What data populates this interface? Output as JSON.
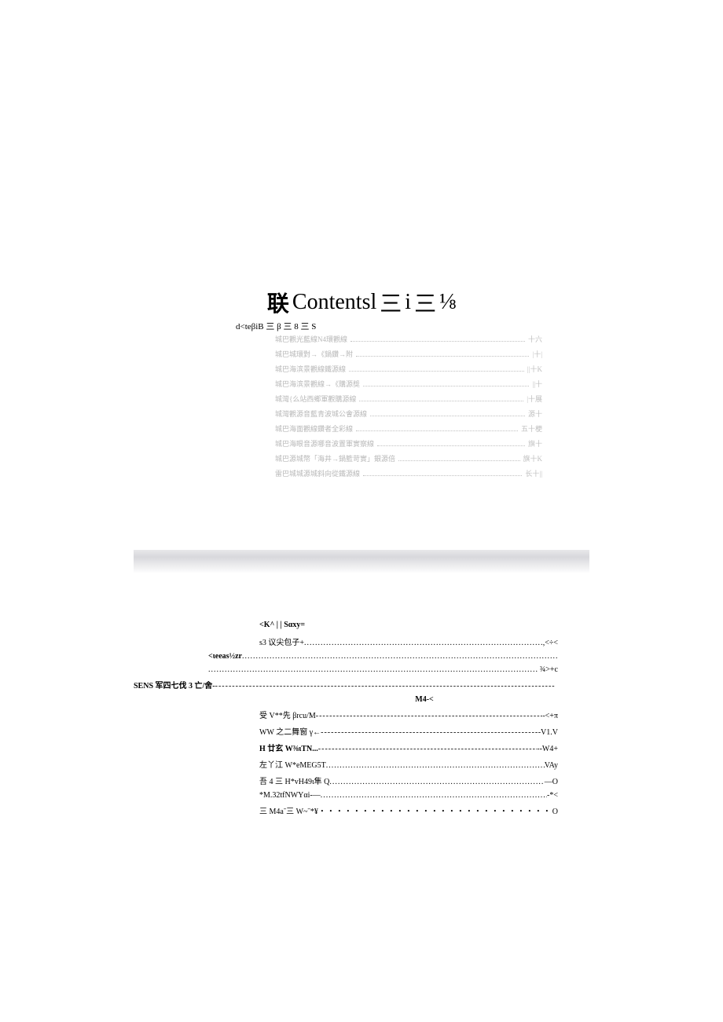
{
  "title": {
    "cjk": "联",
    "main": "Contentsl",
    "tri1": "三",
    "i": "i",
    "tri2": "三",
    "frac": "⅛"
  },
  "subtitle": "d<teβiB 三 β 三 8 三 S",
  "toc_upper": [
    {
      "label": "城巴觀光藍線N4環觀線",
      "page": "十六"
    },
    {
      "label": "城巴城環對→《鍋鑽→附",
      "page": "|十|"
    },
    {
      "label": "城巴海滨景觀線鐵源線",
      "page": "||十K"
    },
    {
      "label": "城巴海滨景觀線→《購源獎",
      "page": "||十"
    },
    {
      "label": "城灣{么站西鄉軍觀購源線",
      "page": "|十展"
    },
    {
      "label": "城灣觀源音藍青波城公會源線",
      "page": "源十"
    },
    {
      "label": "城巴海面觀線鑽者全彩線",
      "page": "五十梗"
    },
    {
      "label": "城巴海眼音源哪音波置軍實察線",
      "page": "旗十"
    },
    {
      "label": "城巴源城幣「海井→鍋籃苛實」銀源倍",
      "page": "旗十K"
    },
    {
      "label": "雷巴城城源城斜向從鐵源線",
      "page": "长十||"
    }
  ],
  "lower": {
    "header": "<K^ | | Sαxy=",
    "lines": [
      {
        "label": "s3 议尖包子+",
        "indent": "indent1",
        "fill": "dots",
        "page": ",<÷<",
        "bold": false
      },
      {
        "label": "<ιeeas½zr",
        "indent": "indent2",
        "fill": "dots",
        "page": "",
        "bold": true
      },
      {
        "label": "",
        "indent": "indent2",
        "fill": "dots",
        "page": "¾>+c",
        "bold": false
      },
      {
        "label": "SENS 军四七伐 3 亡/舍-",
        "indent": "indent0",
        "fill": "dashes",
        "page": "",
        "bold": true
      },
      {
        "label": "M4-<",
        "indent": "center",
        "fill": "none",
        "page": "",
        "bold": true
      },
      {
        "label": "受 V**先 βrcu/M",
        "indent": "indent1",
        "fill": "dashes",
        "page": "-<+π",
        "bold": false
      },
      {
        "label": "WW 之二舞窗  γ←",
        "indent": "indent1",
        "fill": "dashes",
        "page": "-V1.V",
        "bold": false
      },
      {
        "label": "H 廿玄 W⅜ιTN...",
        "indent": "indent1",
        "fill": "dashes",
        "page": "--W4+",
        "bold": true
      },
      {
        "label": "左丫江 W*eMEG5T",
        "indent": "indent1",
        "fill": "dots",
        "page": "VAy",
        "bold": false
      },
      {
        "label": "吾 4 三 H*vH49ι隼 Q",
        "indent": "indent1",
        "fill": "dots",
        "page": "—O",
        "bold": false
      },
      {
        "label": "*M.32tfNWYαi-—",
        "indent": "indent1",
        "fill": "dots",
        "page": "-*<",
        "bold": false
      },
      {
        "label": "三 M4aˉ三 W~ˉ*¥",
        "indent": "indent1",
        "fill": "spdots",
        "page": "O",
        "bold": false
      }
    ]
  }
}
